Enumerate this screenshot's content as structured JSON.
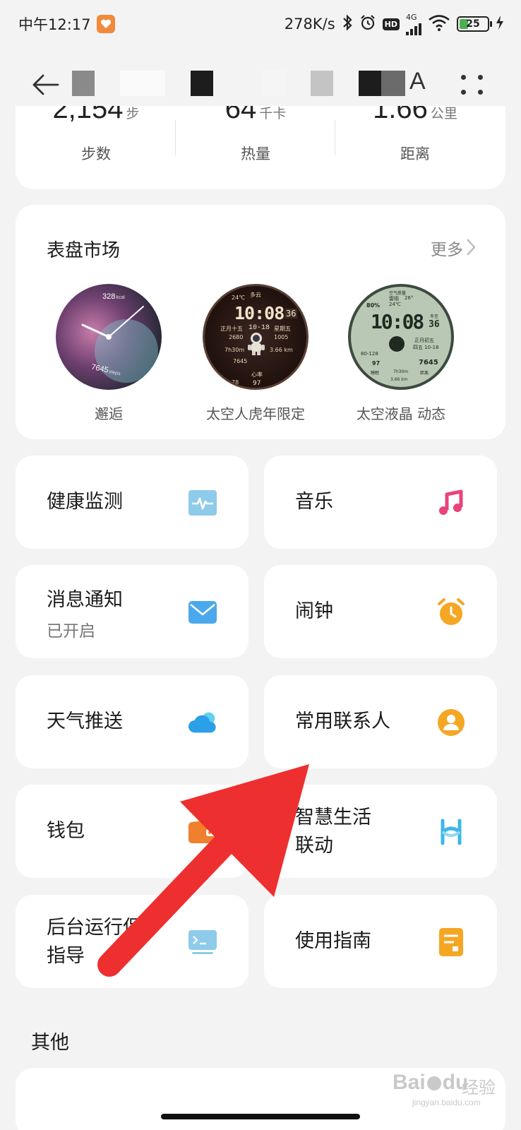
{
  "status_bar": {
    "time": "中午12:17",
    "network_speed": "278K/s",
    "hd_badge": "HD",
    "signal_label": "4G",
    "battery": "25"
  },
  "app_bar": {
    "title_suffix": "A",
    "back_icon": "arrow-left-icon",
    "more_icon": "four-dots-icon"
  },
  "stats": [
    {
      "value": "2,154",
      "unit": "步",
      "label": "步数"
    },
    {
      "value": "64",
      "unit": "千卡",
      "label": "热量"
    },
    {
      "value": "1.66",
      "unit": "公里",
      "label": "距离"
    }
  ],
  "watchface_market": {
    "title": "表盘市场",
    "more": "更多",
    "items": [
      {
        "name": "邂逅",
        "kcal": "328",
        "kcal_unit": "kcal",
        "steps": "7645",
        "steps_unit": "steps"
      },
      {
        "name": "太空人虎年限定",
        "time": "10:08",
        "sec": "36",
        "date": "10-18",
        "temp": "24℃",
        "weekday": "星期五",
        "lunar": "正月十五",
        "steps": "7645",
        "dist": "3.66 km",
        "hr": "97",
        "kcal": "1005",
        "sleep": "7h30m",
        "val_a": "2680",
        "heart_label": "心率",
        "weather": "多云",
        "range": "78"
      },
      {
        "name": "太空液晶 动态",
        "time": "10:08",
        "sec": "36",
        "air": "空气质量",
        "weather": "雷雨",
        "temp": "26°",
        "temp2": "24℃",
        "pct": "80%",
        "season": "冬至",
        "lunar": "正月初五",
        "date": "四五 10-18",
        "hr_range": "80-128",
        "hr": "97",
        "steps": "7645",
        "sleep_label": "睡眠",
        "sleep": "7h30m",
        "dist_label": "距离",
        "dist": "3.66 km"
      }
    ]
  },
  "features": [
    {
      "label": "健康监测",
      "icon": "heartbeat-monitor-icon",
      "color": "#7fc6ea"
    },
    {
      "label": "音乐",
      "icon": "music-note-icon",
      "color": "#e8437a"
    },
    {
      "label": "消息通知",
      "sub": "已开启",
      "icon": "mail-icon",
      "color": "#4aa8ec"
    },
    {
      "label": "闹钟",
      "icon": "alarm-clock-icon",
      "color": "#f5a623"
    },
    {
      "label": "天气推送",
      "icon": "cloud-icon",
      "color": "#2b9fe8"
    },
    {
      "label": "常用联系人",
      "icon": "contact-person-icon",
      "color": "#f5a623"
    },
    {
      "label": "钱包",
      "icon": "wallet-icon",
      "color": "#f07f2e"
    },
    {
      "label": "智慧生活",
      "label2": "联动",
      "icon": "smart-life-icon",
      "color": "#3fb7e8"
    },
    {
      "label": "后台运行保护",
      "label2": "指导",
      "icon": "terminal-icon",
      "color": "#7fc6ea"
    },
    {
      "label": "使用指南",
      "icon": "guide-document-icon",
      "color": "#f5a623"
    }
  ],
  "others": {
    "title": "其他"
  },
  "watermark": {
    "brand": "Bai",
    "brand2": "du",
    "cn": "经验",
    "site": "jingyan.baidu.com"
  },
  "colors": {
    "annotation_arrow": "#ee2f2f",
    "card": "#ffffff",
    "background": "#f3f3f3"
  }
}
